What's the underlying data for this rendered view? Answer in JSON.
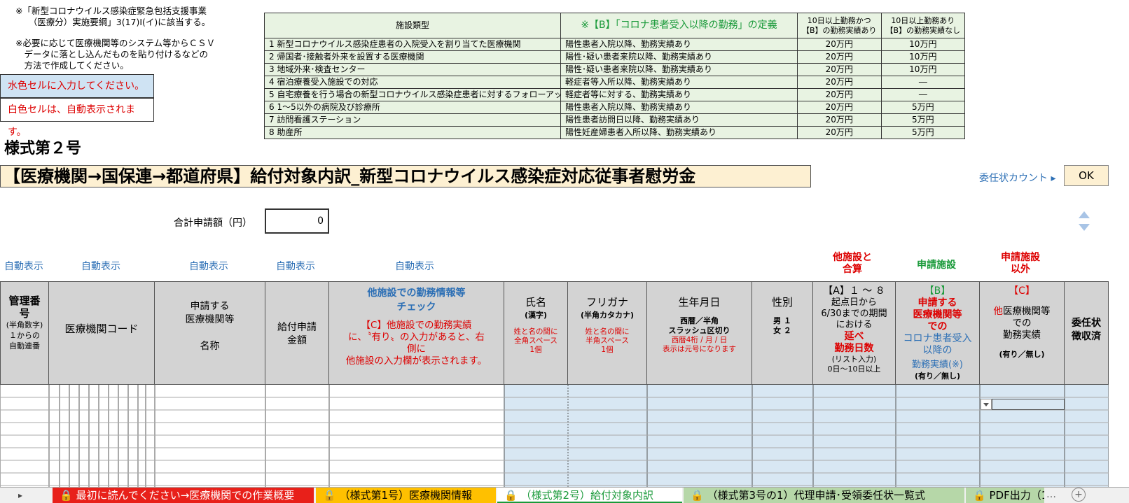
{
  "notes": {
    "line1": "※「新型コロナウイルス感染症緊急包括支援事業\n　　（医療分）実施要綱」3(17)Ⅰ(イ)に該当する。",
    "line2": "※必要に応じて医療機関等のシステム等からＣＳＶ\n　データに落とし込んだものを貼り付けるなどの\n　方法で作成してください。"
  },
  "legend": {
    "input": "水色セルに入力してください。",
    "auto": "白色セルは、自動表示されます。"
  },
  "ref_table": {
    "headers": [
      "施設類型",
      "※【B】「コロナ患者受入以降の勤務」の定義",
      "10日以上勤務かつ\n【B】の勤務実績あり",
      "10日以上勤務あり\n【B】の勤務実績なし"
    ],
    "rows": [
      [
        "1 新型コロナウイルス感染症患者の入院受入を割り当てた医療機関",
        "陽性患者入院以降、勤務実績あり",
        "20万円",
        "10万円"
      ],
      [
        "2 帰国者･接触者外来を設置する医療機関",
        "陽性･疑い患者来院以降、勤務実績あり",
        "20万円",
        "10万円"
      ],
      [
        "3 地域外来･検査センター",
        "陽性･疑い患者来院以降、勤務実績あり",
        "20万円",
        "10万円"
      ],
      [
        "4 宿泊療養受入施設での対応",
        "軽症者等入所以降、勤務実績あり",
        "20万円",
        "―"
      ],
      [
        "5 自宅療養を行う場合の新型コロナウイルス感染症患者に対するフォローアッ",
        "軽症者等に対する、勤務実績あり",
        "20万円",
        "―"
      ],
      [
        "6 1～5以外の病院及び診療所",
        "陽性患者入院以降、勤務実績あり",
        "20万円",
        "5万円"
      ],
      [
        "7 訪問看護ステーション",
        "陽性患者訪問日以降、勤務実績あり",
        "20万円",
        "5万円"
      ],
      [
        "8 助産所",
        "陽性妊産婦患者入所以降、勤務実績あり",
        "20万円",
        "5万円"
      ]
    ]
  },
  "form_no": "様式第２号",
  "title": "【医療機関→国保連→都道府県】給付対象内訳_新型コロナウイルス感染症対応従事者慰労金",
  "inin_count_label": "委任状カウント ▸",
  "ok_label": "OK",
  "total_label": "合計申請額（円）",
  "total_value": "0",
  "auto_labels": [
    "自動表示",
    "自動表示",
    "自動表示",
    "自動表示",
    "自動表示"
  ],
  "group_labels": {
    "other_total": "他施設と\n合算",
    "applying": "申請施設",
    "not_applying": "申請施設\n以外"
  },
  "columns": {
    "kanri": "管理番\n号",
    "kanri_sub": "(半角数字)\n１からの\n自動連番",
    "code": "医療機関コード",
    "name": "申請する\n医療機関等\n\n名称",
    "amount": "給付申請\n金額",
    "check_title": "他施設での勤務情報等\nチェック",
    "check_body": "【C】他施設での勤務実績\nに、〝有り〟の入力があると、右\n側に\n他施設の入力欄が表示されます。",
    "shimei": "氏名",
    "shimei_sub": "(漢字)",
    "shimei_note": "姓と名の間に\n全角スペース\n1個",
    "furigana": "フリガナ",
    "furigana_sub": "(半角カタカナ)",
    "furigana_note": "姓と名の間に\n半角スペース\n1個",
    "birth": "生年月日",
    "birth_sub": "西暦／半角\nスラッシュ区切り",
    "birth_note": "西暦4桁 / 月 / 日\n表示は元号になります",
    "sex": "性別",
    "sex_sub": "男 １\n女 ２",
    "a_title": "【A】１ ～ ８",
    "a_body": "起点日から\n6/30までの期間\nにおける",
    "a_red": "延べ\n勤務日数",
    "a_sub": "(リスト入力)\n0日～10日以上",
    "b_title": "【B】",
    "b_red": "申請する\n医療機関等\nでの",
    "b_blue": "コロナ患者受入\n以降の",
    "b_tail": "勤務実績(※)",
    "b_sub": "(有り／無し)",
    "c_title": "【C】",
    "c_red": "他",
    "c_body": "医療機関等\nでの\n勤務実績",
    "c_sub": "(有り／無し)",
    "inin": "委任状\n徴収済"
  },
  "tabs": [
    "最初に読んでください→医療機関での作業概要",
    "（様式第1号）医療機関情報",
    "（様式第2号）給付対象内訳",
    "（様式第3号の1）代理申請･受領委任状一覧式",
    "PDF出力（1"
  ]
}
